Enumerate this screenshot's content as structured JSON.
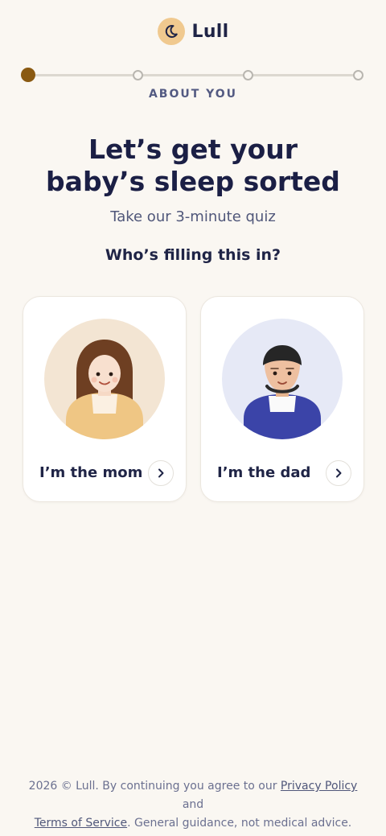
{
  "brand": {
    "name": "Lull",
    "icon": "moon-icon",
    "icon_bg": "#f0c98f"
  },
  "progress": {
    "step_label": "ABOUT YOU",
    "total_steps": 4,
    "current_step": 1,
    "active_color": "#8a5a12"
  },
  "hero": {
    "title_line1": "Let’s get your",
    "title_line2": "baby’s sleep sorted",
    "subtitle": "Take our 3-minute quiz"
  },
  "question": "Who’s filling this in?",
  "options": [
    {
      "label": "I’m the mom",
      "icon": "chevron-right-icon"
    },
    {
      "label": "I’m the dad",
      "icon": "chevron-right-icon"
    }
  ],
  "footer": {
    "prefix": "2026 © Lull. By continuing you agree to our",
    "privacy_link": "Privacy Policy",
    "and": "and",
    "terms_link": "Terms of Service",
    "suffix": ". General guidance, not medical advice."
  }
}
